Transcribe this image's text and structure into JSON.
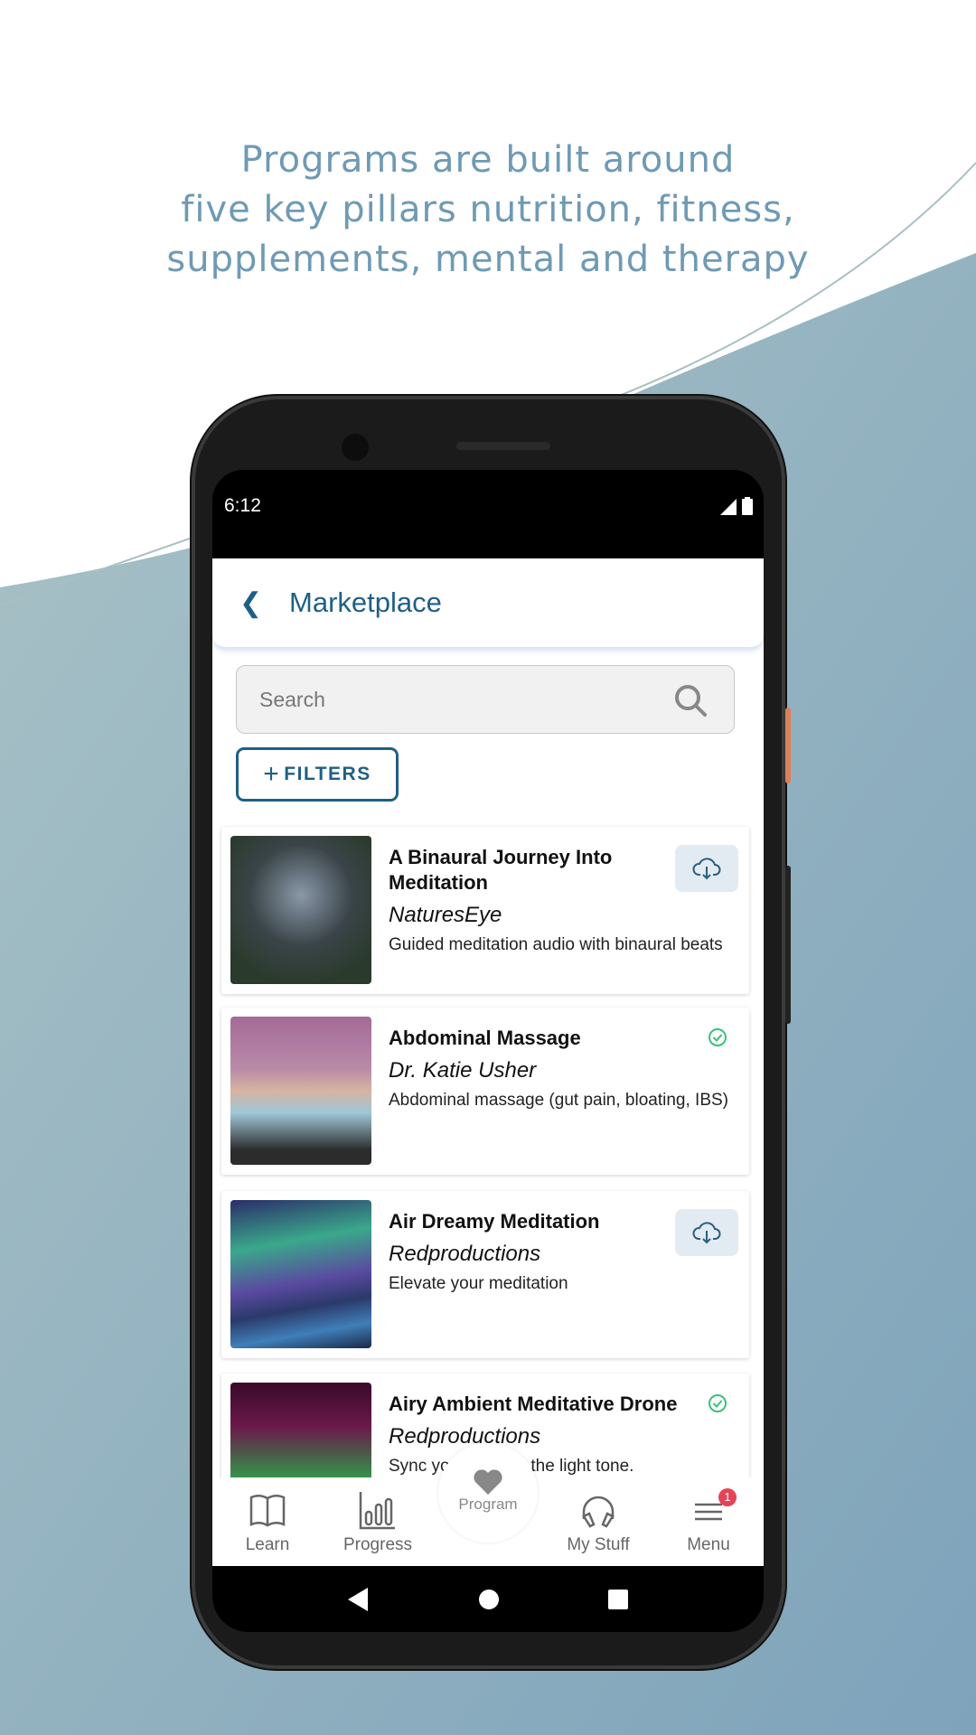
{
  "headline": {
    "line1": "Programs are built around",
    "line2": "five key pillars nutrition, fitness,",
    "line3": "supplements, mental and therapy"
  },
  "colors": {
    "accent": "#1f5f85",
    "headline": "#6f9ab4",
    "background_wave": "#8fb0bd",
    "badge": "#e44456",
    "check": "#3cbf7a"
  },
  "status": {
    "time": "6:12"
  },
  "header": {
    "back_icon": "chevron-left-icon",
    "title": "Marketplace"
  },
  "search": {
    "placeholder": "Search"
  },
  "filters": {
    "label": "FILTERS"
  },
  "items": [
    {
      "title": "A Binaural Journey Into Meditation",
      "author": "NaturesEye",
      "description": "Guided meditation audio with binaural beats",
      "status": "download"
    },
    {
      "title": "Abdominal Massage",
      "author": "Dr. Katie Usher",
      "description": "Abdominal massage (gut pain, bloating, IBS)",
      "status": "owned"
    },
    {
      "title": "Air Dreamy Meditation",
      "author": "Redproductions",
      "description": "Elevate your meditation",
      "status": "download"
    },
    {
      "title": "Airy Ambient Meditative Drone",
      "author": "Redproductions",
      "description": "Sync your mind to the light tone.",
      "status": "owned"
    }
  ],
  "nav": {
    "learn": "Learn",
    "progress": "Progress",
    "program": "Program",
    "mystuff": "My Stuff",
    "menu": "Menu",
    "menu_badge": "1"
  }
}
